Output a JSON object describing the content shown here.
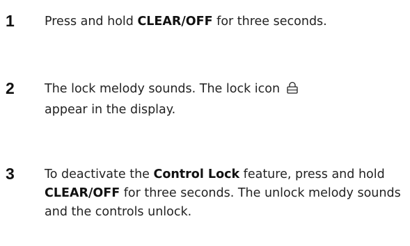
{
  "steps": [
    {
      "number": "1",
      "parts": [
        "Press and hold ",
        "CLEAR/OFF",
        " for three seconds."
      ]
    },
    {
      "number": "2",
      "parts": [
        "The lock melody sounds. The lock icon",
        "appear in the display."
      ],
      "icon": "lock-icon"
    },
    {
      "number": "3",
      "parts": [
        "To deactivate the ",
        "Control Lock",
        " feature, press and hold ",
        "CLEAR/OFF",
        " for three seconds. The unlock melody sounds and the controls unlock."
      ]
    }
  ]
}
